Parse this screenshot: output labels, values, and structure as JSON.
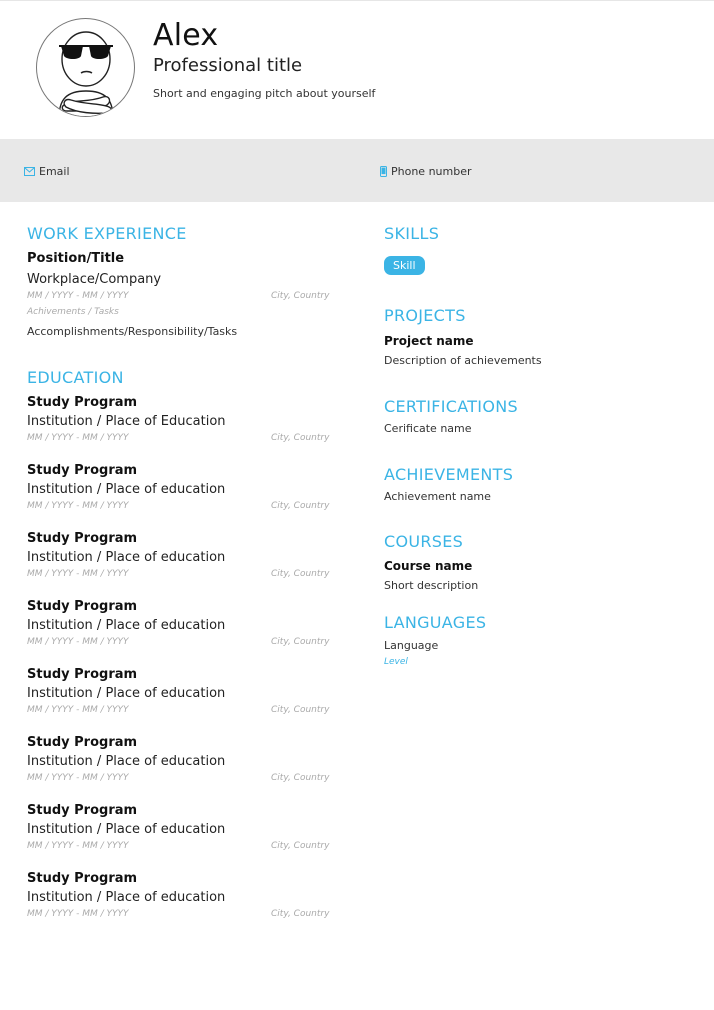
{
  "header": {
    "name": "Alex",
    "title": "Professional title",
    "pitch": "Short and engaging pitch about yourself"
  },
  "contact": {
    "email_label": "Email",
    "phone_label": "Phone number",
    "bar_color": "#e8e8e8",
    "icon_color": "#3bb4e5"
  },
  "work": {
    "heading": "WORK EXPERIENCE",
    "position": "Position/Title",
    "company": "Workplace/Company",
    "dates": "MM / YYYY - MM / YYYY",
    "location": "City, Country",
    "tasks_label": "Achivements / Tasks",
    "accomplishments": "Accomplishments/Responsibility/Tasks"
  },
  "education": {
    "heading": "EDUCATION",
    "items": [
      {
        "program": "Study Program",
        "institution": "Institution / Place of Education",
        "dates": "MM / YYYY - MM / YYYY",
        "location": "City, Country"
      },
      {
        "program": "Study Program",
        "institution": "Institution / Place of education",
        "dates": "MM / YYYY - MM / YYYY",
        "location": "City, Country"
      },
      {
        "program": "Study Program",
        "institution": "Institution / Place of education",
        "dates": "MM / YYYY - MM / YYYY",
        "location": "City, Country"
      },
      {
        "program": "Study Program",
        "institution": "Institution / Place of education",
        "dates": "MM / YYYY - MM / YYYY",
        "location": "City, Country"
      },
      {
        "program": "Study Program",
        "institution": "Institution / Place of education",
        "dates": "MM / YYYY - MM / YYYY",
        "location": "City, Country"
      },
      {
        "program": "Study Program",
        "institution": "Institution / Place of education",
        "dates": "MM / YYYY - MM / YYYY",
        "location": "City, Country"
      },
      {
        "program": "Study Program",
        "institution": "Institution / Place of education",
        "dates": "MM / YYYY - MM / YYYY",
        "location": "City, Country"
      },
      {
        "program": "Study Program",
        "institution": "Institution / Place of education",
        "dates": "MM / YYYY - MM / YYYY",
        "location": "City, Country"
      }
    ]
  },
  "skills": {
    "heading": "SKILLS",
    "items": [
      "Skill"
    ]
  },
  "projects": {
    "heading": "PROJECTS",
    "name": "Project name",
    "description": "Description of achievements"
  },
  "certifications": {
    "heading": "CERTIFICATIONS",
    "name": "Cerificate name"
  },
  "achievements": {
    "heading": "ACHIEVEMENTS",
    "name": "Achievement name"
  },
  "courses": {
    "heading": "COURSES",
    "name": "Course name",
    "description": "Short description"
  },
  "languages": {
    "heading": "LANGUAGES",
    "language": "Language",
    "level": "Level"
  },
  "accent_color": "#3bb4e5"
}
